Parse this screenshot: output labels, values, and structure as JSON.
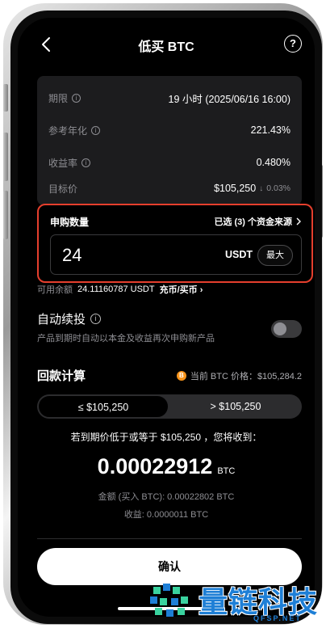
{
  "header": {
    "title": "低买 BTC",
    "help_glyph": "?"
  },
  "info": {
    "rows": [
      {
        "label": "期限",
        "value": "19 小时 (2025/06/16 16:00)",
        "has_info": true
      },
      {
        "label": "参考年化",
        "value": "221.43%",
        "has_info": true
      },
      {
        "label": "收益率",
        "value": "0.480%",
        "has_info": true
      },
      {
        "label": "目标价",
        "value": "$105,250",
        "has_info": false
      }
    ],
    "target_change": "0.03%"
  },
  "subscribe": {
    "label": "申购数量",
    "sources_link": "已选 (3) 个资金来源",
    "amount": "24",
    "unit": "USDT",
    "max_label": "最大"
  },
  "balance": {
    "label": "可用余额",
    "value": "24.11160787 USDT",
    "link": "充币/买币"
  },
  "auto_renew": {
    "title": "自动续投",
    "description": "产品到期时自动以本金及收益再次申购新产品",
    "enabled": false
  },
  "calc": {
    "title": "回款计算",
    "price_label": "当前 BTC 价格：$105,284.2",
    "btc_glyph": "B",
    "tabs": [
      "≤ $105,250",
      "> $105,250"
    ],
    "selected_tab": 0,
    "receive_text": "若到期价低于或等于 $105,250 ，您将收到：",
    "receive_amount": "0.00022912",
    "receive_unit": "BTC",
    "principal_line": "金额 (买入 BTC): 0.00022802 BTC",
    "yield_line": "收益: 0.0000011 BTC"
  },
  "confirm_label": "确认",
  "watermark": {
    "text": "量链科技",
    "sub": "QFSP.NET"
  },
  "colors": {
    "highlight_border": "#e53f2d",
    "btc": "#f7931a",
    "watermark": "#1e7fd6"
  }
}
